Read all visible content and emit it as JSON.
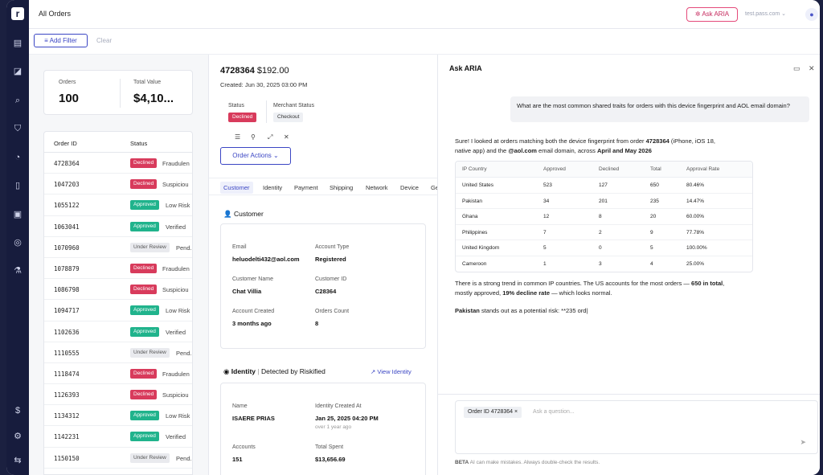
{
  "app": {
    "logo_letter": "r",
    "page_title": "All Orders"
  },
  "topbar": {
    "ask_aria_label": "Ask ARIA",
    "domain": "test.pass.com",
    "domain_chevron": "⌄"
  },
  "filters": {
    "add_filter_label": "Add Filter",
    "clear_label": "Clear"
  },
  "stats": {
    "orders_label": "Orders",
    "orders_value": "100",
    "total_value_label": "Total Value",
    "total_value": "$4,10..."
  },
  "orders_table": {
    "columns": [
      "Order ID",
      "Status"
    ],
    "rows": [
      {
        "id": "4728364",
        "status": "Declined",
        "reason": "Fraudulen"
      },
      {
        "id": "1047203",
        "status": "Declined",
        "reason": "Suspiciou"
      },
      {
        "id": "1055122",
        "status": "Approved",
        "reason": "Low Risk"
      },
      {
        "id": "1063041",
        "status": "Approved",
        "reason": "Verified"
      },
      {
        "id": "1070960",
        "status": "Under Review",
        "reason": "Pend."
      },
      {
        "id": "1078879",
        "status": "Declined",
        "reason": "Fraudulen"
      },
      {
        "id": "1086798",
        "status": "Declined",
        "reason": "Suspiciou"
      },
      {
        "id": "1094717",
        "status": "Approved",
        "reason": "Low Risk"
      },
      {
        "id": "1102636",
        "status": "Approved",
        "reason": "Verified"
      },
      {
        "id": "1110555",
        "status": "Under Review",
        "reason": "Pend."
      },
      {
        "id": "1118474",
        "status": "Declined",
        "reason": "Fraudulen"
      },
      {
        "id": "1126393",
        "status": "Declined",
        "reason": "Suspiciou"
      },
      {
        "id": "1134312",
        "status": "Approved",
        "reason": "Low Risk"
      },
      {
        "id": "1142231",
        "status": "Approved",
        "reason": "Verified"
      },
      {
        "id": "1150150",
        "status": "Under Review",
        "reason": "Pend."
      }
    ]
  },
  "order": {
    "id": "4728364",
    "amount": "$192.00",
    "created_label": "Created:",
    "created_value": "Jun 30, 2025 03:00 PM",
    "status_label": "Status",
    "status_value": "Declined",
    "merchant_status_label": "Merchant Status",
    "merchant_status_value": "Checkout",
    "actions_label": "Order Actions",
    "tabs": [
      "Customer",
      "Identity",
      "Payment",
      "Shipping",
      "Network",
      "Device",
      "Ge"
    ]
  },
  "customer": {
    "section_title": "Customer",
    "email_label": "Email",
    "email": "heluodelti432@aol.com",
    "account_type_label": "Account Type",
    "account_type": "Registered",
    "name_label": "Customer Name",
    "name": "Chat Villia",
    "customer_id_label": "Customer ID",
    "customer_id": "C28364",
    "account_created_label": "Account Created",
    "account_created": "3 months ago",
    "orders_count_label": "Orders Count",
    "orders_count": "8"
  },
  "identity": {
    "section_title": "Identity",
    "detected_by": "Detected by Riskified",
    "view_link": "View Identity",
    "name_label": "Name",
    "name": "ISAERE PRIAS",
    "created_label": "Identity Created At",
    "created": "Jan 25, 2025 04:20 PM",
    "created_sub": "over 1 year ago",
    "accounts_label": "Accounts",
    "accounts": "151",
    "total_spent_label": "Total Spent",
    "total_spent": "$13,656.69"
  },
  "aria": {
    "title": "Ask ARIA",
    "user_question": "What are the most common shared traits for orders with this device fingerprint and AOL email domain?",
    "answer_intro_1": "Sure! I looked at orders matching both the device fingerprint from order ",
    "answer_intro_order": "4728364",
    "answer_intro_2": " (iPhone, iOS 18,",
    "answer_intro_3": "native app) and the ",
    "answer_intro_domain": "@aol.com",
    "answer_intro_4": " email domain, across ",
    "answer_intro_period": "April and May 2026",
    "table_columns": [
      "IP Country",
      "Approved",
      "Declined",
      "Total",
      "Approval Rate"
    ],
    "table_rows": [
      [
        "United States",
        "523",
        "127",
        "650",
        "80.46%"
      ],
      [
        "Pakistan",
        "34",
        "201",
        "235",
        "14.47%"
      ],
      [
        "Ghana",
        "12",
        "8",
        "20",
        "60.00%"
      ],
      [
        "Philippines",
        "7",
        "2",
        "9",
        "77.78%"
      ],
      [
        "United Kingdom",
        "5",
        "0",
        "5",
        "100.00%"
      ],
      [
        "Cameroon",
        "1",
        "3",
        "4",
        "25.00%"
      ]
    ],
    "trend_1": "There is a strong trend in common IP countries. The US accounts for the most orders — ",
    "trend_bold_1": "650 in total",
    "trend_2": ",",
    "trend_3": "mostly approved, ",
    "trend_bold_2": "19% decline rate",
    "trend_4": " — which looks normal.",
    "pakistan_bold": "Pakistan",
    "pakistan_rest": " stands out as a potential risk: **235 ord",
    "composer_tag": "Order ID 4728364",
    "composer_placeholder": "Ask a question...",
    "beta_label": "BETA",
    "beta_note": "AI can make mistakes. Always double-check the results."
  },
  "colors": {
    "brand": "#3b46c4",
    "declined": "#d83b5c",
    "approved": "#20b38c",
    "rail": "#171c3d",
    "aria_accent": "#e44a7a"
  }
}
